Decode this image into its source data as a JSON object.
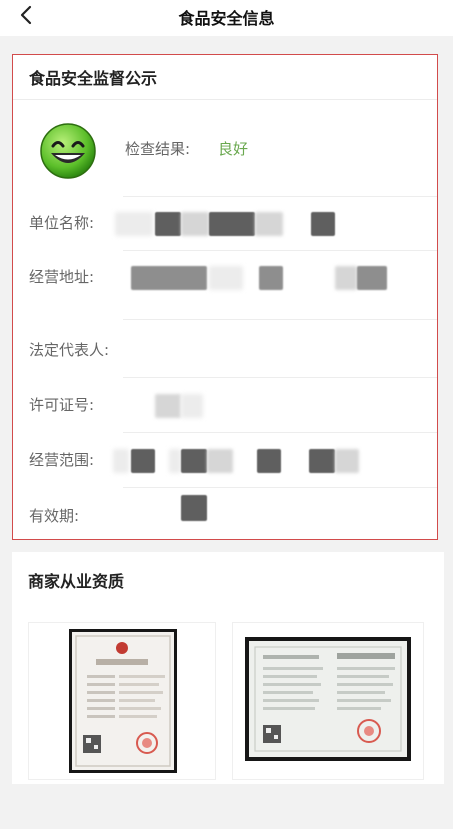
{
  "nav": {
    "title": "食品安全信息"
  },
  "supervision": {
    "title": "食品安全监督公示",
    "inspection_label": "检查结果:",
    "inspection_result": "良好",
    "fields": [
      {
        "label": "单位名称:"
      },
      {
        "label": "经营地址:"
      },
      {
        "label": "法定代表人:"
      },
      {
        "label": "许可证号:"
      },
      {
        "label": "经营范围:"
      },
      {
        "label": "有效期:"
      }
    ]
  },
  "qualifications": {
    "title": "商家从业资质"
  },
  "colors": {
    "highlight_border": "#d24b4b",
    "good_result": "#6aa84f"
  },
  "icons": [
    "back-chevron-icon",
    "smiling-face-icon"
  ]
}
